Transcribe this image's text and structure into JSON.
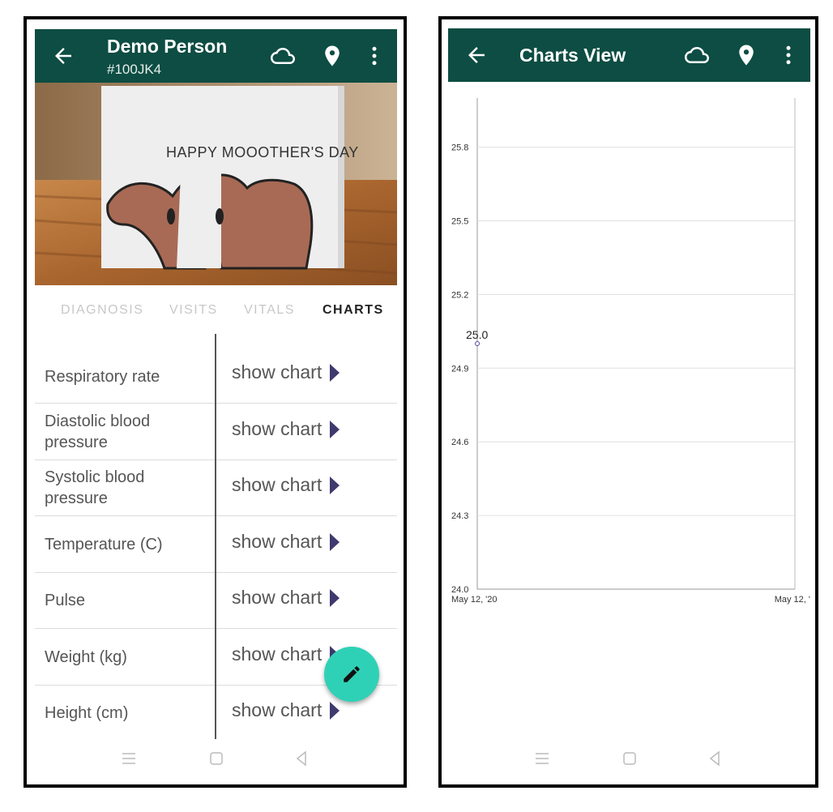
{
  "left_screen": {
    "header": {
      "title": "Demo Person",
      "subtitle": "#100JK4"
    },
    "hero": {
      "card_text": "HAPPY MOOOTHER'S DAY"
    },
    "tabs": [
      {
        "label": "DIAGNOSIS",
        "active": false
      },
      {
        "label": "VISITS",
        "active": false
      },
      {
        "label": "VITALS",
        "active": false
      },
      {
        "label": "CHARTS",
        "active": true
      }
    ],
    "rows": [
      {
        "label": "Respiratory rate",
        "action": "show chart"
      },
      {
        "label": "Diastolic blood pressure",
        "action": "show chart"
      },
      {
        "label": "Systolic blood pressure",
        "action": "show chart"
      },
      {
        "label": "Temperature (C)",
        "action": "show chart"
      },
      {
        "label": "Pulse",
        "action": "show chart"
      },
      {
        "label": "Weight (kg)",
        "action": "show chart"
      },
      {
        "label": "Height (cm)",
        "action": "show chart"
      }
    ]
  },
  "right_screen": {
    "header": {
      "title": "Charts View"
    }
  },
  "colors": {
    "appbar": "#0d4d43",
    "fab": "#2fd1b6",
    "arrow": "#3f3a6e"
  },
  "chart_data": {
    "type": "line",
    "x": [
      "May 12, '20"
    ],
    "x_tick_labels": [
      "May 12, '20",
      "May 12, '"
    ],
    "y_ticks": [
      "24.0",
      "24.3",
      "24.6",
      "24.9",
      "25.2",
      "25.5",
      "25.8"
    ],
    "ylim": [
      24.0,
      26.0
    ],
    "series": [
      {
        "values": [
          25.0
        ]
      }
    ],
    "point_labels": [
      "25.0"
    ],
    "grid": true
  }
}
